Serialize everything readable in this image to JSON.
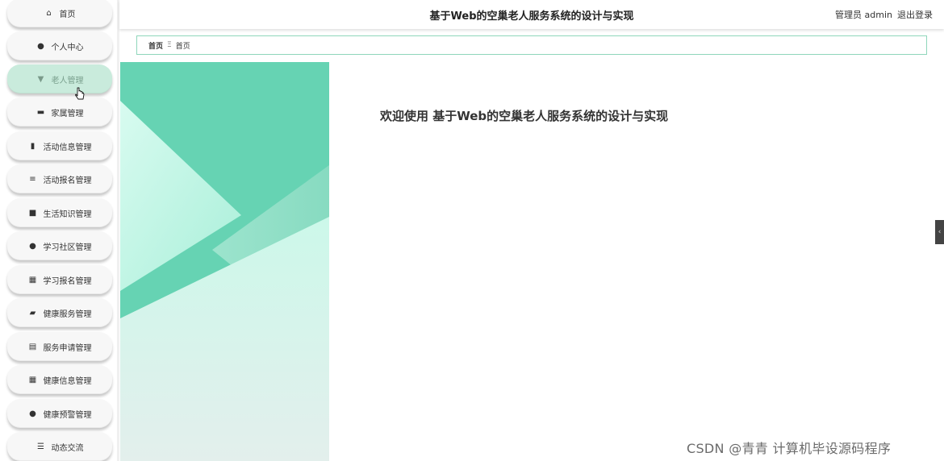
{
  "header": {
    "title": "基于Web的空巢老人服务系统的设计与实现",
    "user_label": "管理员 admin",
    "logout_label": "退出登录"
  },
  "breadcrumb": {
    "home": "首页",
    "separator": "Ξ",
    "current": "首页"
  },
  "welcome": {
    "text": "欢迎使用 基于Web的空巢老人服务系统的设计与实现"
  },
  "sidebar": {
    "items": [
      {
        "label": "首页",
        "icon": "home-icon",
        "glyph": "⌂"
      },
      {
        "label": "个人中心",
        "icon": "user-icon",
        "glyph": "●"
      },
      {
        "label": "老人管理",
        "icon": "filter-icon",
        "glyph": "▼"
      },
      {
        "label": "家属管理",
        "icon": "chat-icon",
        "glyph": "▬"
      },
      {
        "label": "活动信息管理",
        "icon": "book-icon",
        "glyph": "▮"
      },
      {
        "label": "活动报名管理",
        "icon": "list-icon",
        "glyph": "≡"
      },
      {
        "label": "生活知识管理",
        "icon": "monitor-icon",
        "glyph": "■"
      },
      {
        "label": "学习社区管理",
        "icon": "person-icon",
        "glyph": "●"
      },
      {
        "label": "学习报名管理",
        "icon": "grid-icon",
        "glyph": "▦"
      },
      {
        "label": "健康服务管理",
        "icon": "ticket-icon",
        "glyph": "▰"
      },
      {
        "label": "服务申请管理",
        "icon": "document-icon",
        "glyph": "▤"
      },
      {
        "label": "健康信息管理",
        "icon": "grid-icon",
        "glyph": "▦"
      },
      {
        "label": "健康预警管理",
        "icon": "person-icon",
        "glyph": "●"
      },
      {
        "label": "动态交流",
        "icon": "sliders-icon",
        "glyph": "☰"
      }
    ],
    "active_index": 2
  },
  "collapse_tab": {
    "glyph": "‹"
  },
  "watermark": {
    "text": "CSDN @青青  计算机毕设源码程序"
  },
  "colors": {
    "accent": "#66d3b3",
    "accent_light": "#c9f5e8",
    "active_menu_bg": "#c9ebdc",
    "breadcrumb_border": "#8fd6bb"
  }
}
